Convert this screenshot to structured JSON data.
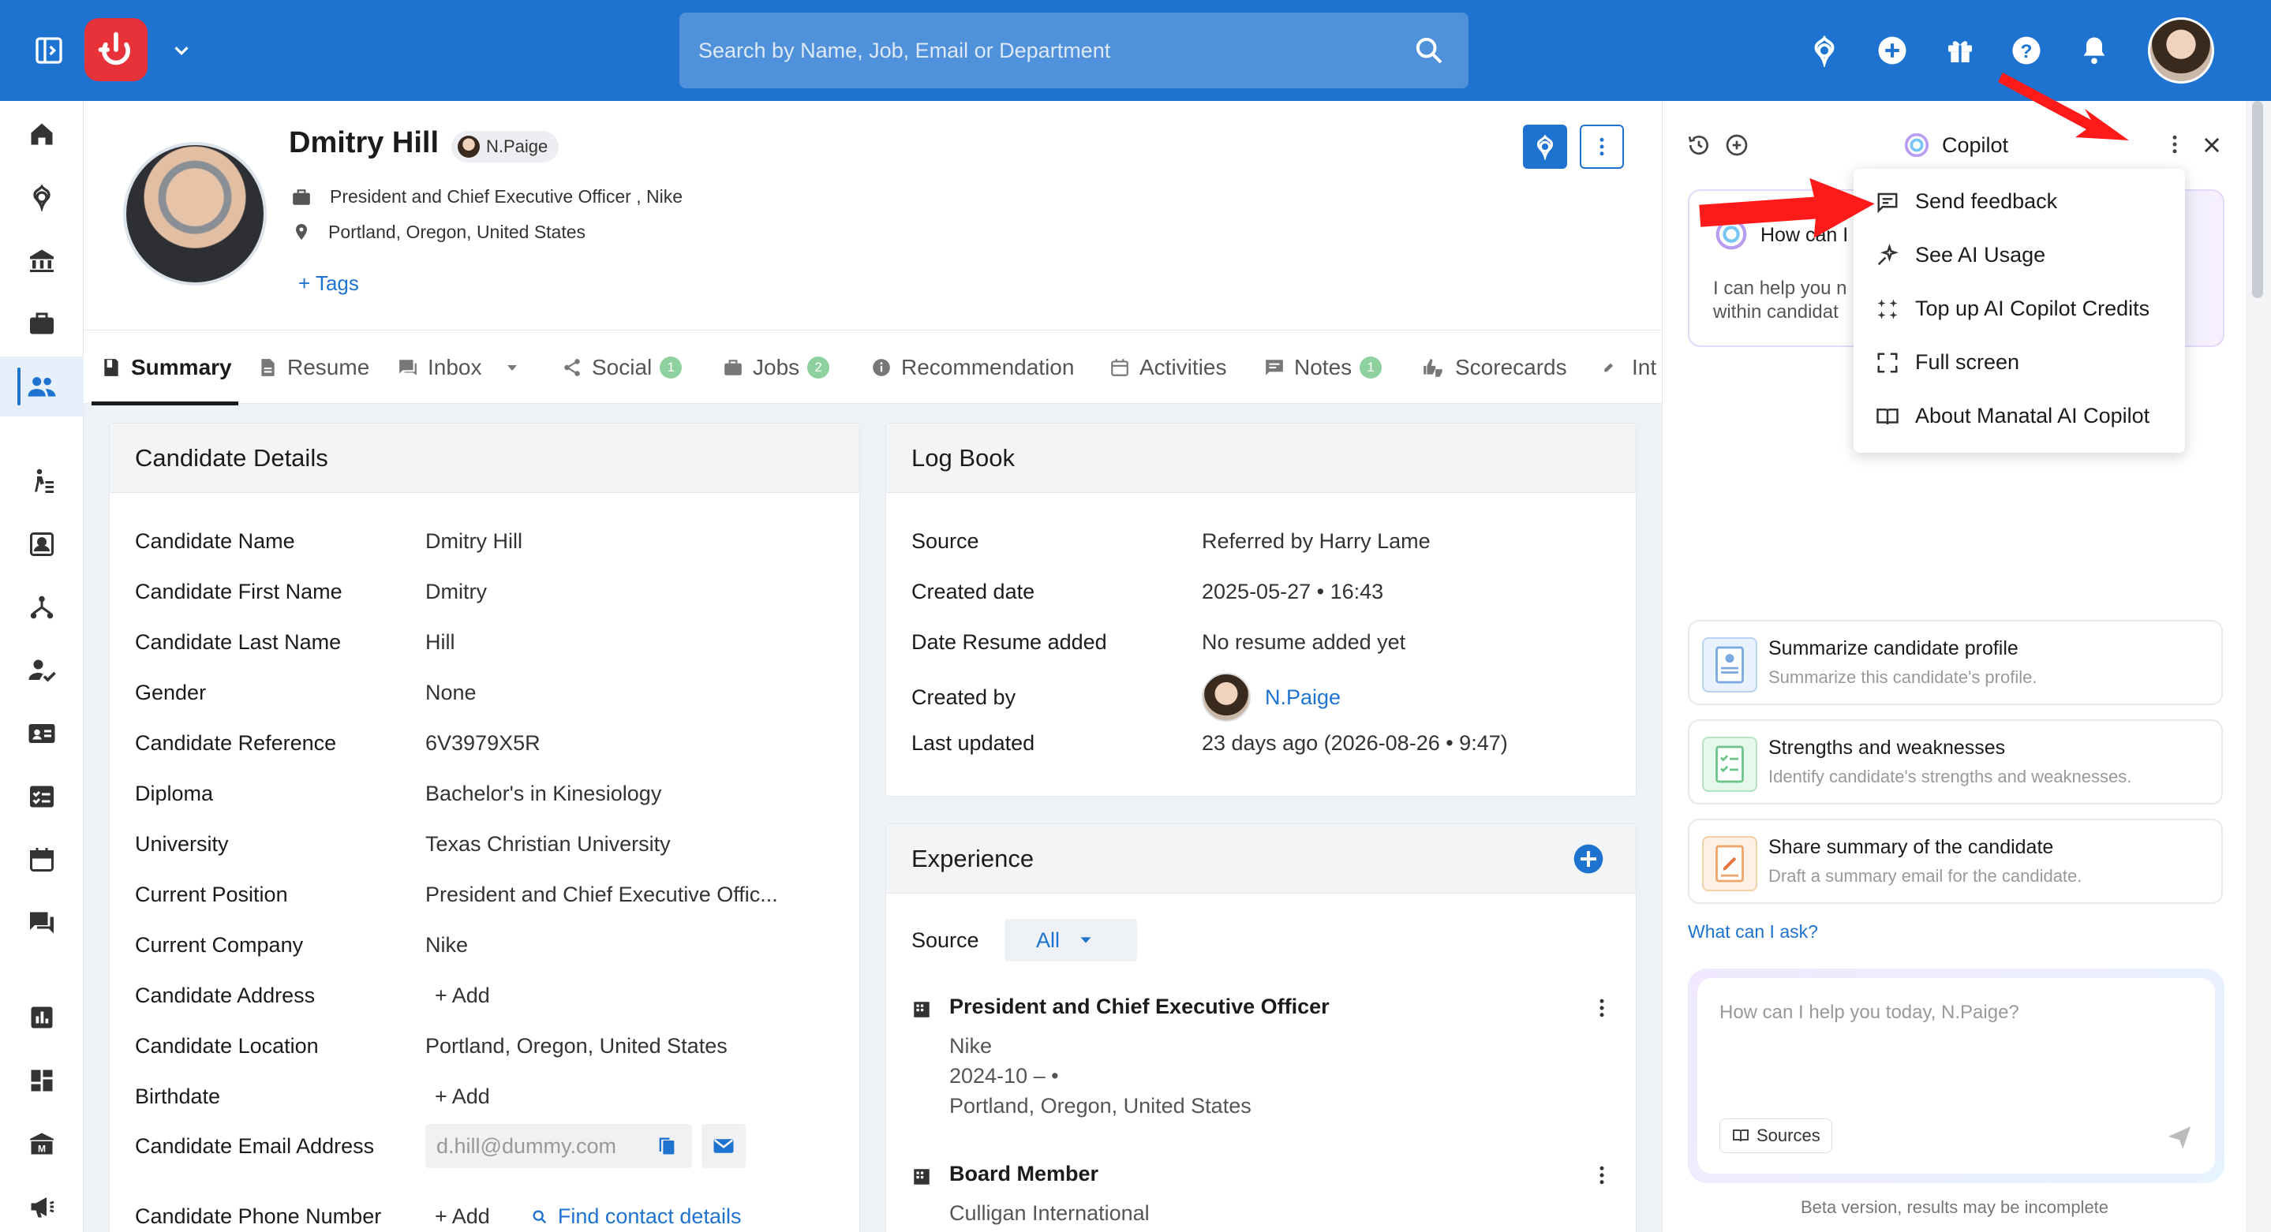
{
  "topbar": {
    "search_placeholder": "Search by Name, Job, Email or Department"
  },
  "profile": {
    "name": "Dmitry Hill",
    "owner": "N.Paige",
    "position": "President and Chief Executive Officer , Nike",
    "location": "Portland, Oregon, United States",
    "tags": "+ Tags"
  },
  "tabs": [
    {
      "label": "Summary"
    },
    {
      "label": "Resume"
    },
    {
      "label": "Inbox"
    },
    {
      "label": "Social",
      "count": "1"
    },
    {
      "label": "Jobs",
      "count": "2"
    },
    {
      "label": "Recommendation"
    },
    {
      "label": "Activities"
    },
    {
      "label": "Notes",
      "count": "1"
    },
    {
      "label": "Scorecards"
    },
    {
      "label": "Int"
    }
  ],
  "candidate_details": {
    "title": "Candidate Details",
    "rows": [
      {
        "k": "Candidate Name",
        "v": "Dmitry Hill"
      },
      {
        "k": "Candidate First Name",
        "v": "Dmitry"
      },
      {
        "k": "Candidate Last Name",
        "v": "Hill"
      },
      {
        "k": "Gender",
        "v": "None"
      },
      {
        "k": "Candidate Reference",
        "v": "6V3979X5R"
      },
      {
        "k": "Diploma",
        "v": "Bachelor's in Kinesiology"
      },
      {
        "k": "University",
        "v": "Texas Christian University"
      },
      {
        "k": "Current Position",
        "v": "President and Chief Executive Offic..."
      },
      {
        "k": "Current Company",
        "v": "Nike"
      },
      {
        "k": "Candidate Address",
        "v": "+ Add"
      },
      {
        "k": "Candidate Location",
        "v": "Portland, Oregon, United States"
      },
      {
        "k": "Birthdate",
        "v": "+ Add"
      },
      {
        "k": "Candidate Email Address",
        "v": "d.hill@dummy.com"
      },
      {
        "k": "Candidate Phone Number",
        "v": "+ Add",
        "v2": "Find contact details"
      }
    ]
  },
  "logbook": {
    "title": "Log Book",
    "rows": [
      {
        "k": "Source",
        "v": "Referred by Harry Lame"
      },
      {
        "k": "Created date",
        "v": "2025-05-27 • 16:43"
      },
      {
        "k": "Date Resume added",
        "v": "No resume added yet"
      },
      {
        "k": "Created by",
        "v": "N.Paige"
      },
      {
        "k": "Last updated",
        "v": "23 days ago (2026-08-26 • 9:47)"
      }
    ]
  },
  "experience": {
    "title": "Experience",
    "source_label": "Source",
    "source_value": "All",
    "items": [
      {
        "title": "President and Chief Executive Officer",
        "company": "Nike",
        "dates": "2024-10 – •",
        "location": "Portland, Oregon, United States"
      },
      {
        "title": "Board Member",
        "company": "Culligan International"
      }
    ]
  },
  "copilot": {
    "title": "Copilot",
    "greeting": "How can I",
    "intro_1": "I can help you n",
    "intro_2": "within candidat",
    "menu": [
      "Send feedback",
      "See AI Usage",
      "Top up AI Copilot Credits",
      "Full screen",
      "About Manatal AI Copilot"
    ],
    "suggestions": [
      {
        "title": "Summarize candidate profile",
        "desc": "Summarize this candidate's profile."
      },
      {
        "title": "Strengths and weaknesses",
        "desc": "Identify candidate's strengths and weaknesses."
      },
      {
        "title": "Share summary of the candidate",
        "desc": "Draft a summary email for the candidate."
      }
    ],
    "what_can_i_ask": "What can I ask?",
    "input_placeholder": "How can I help you today, N.Paige?",
    "sources": "Sources",
    "footer": "Beta version, results may be incomplete"
  }
}
